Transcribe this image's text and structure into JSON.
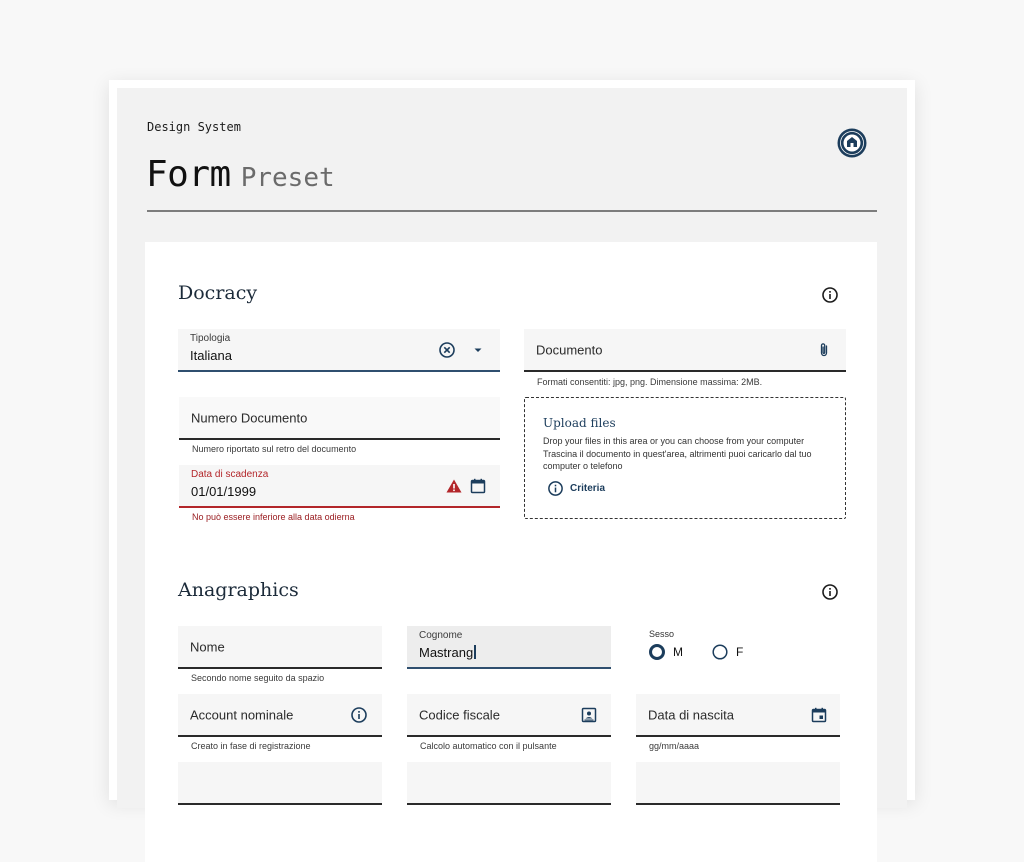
{
  "header": {
    "eyebrow": "Design System",
    "title": "Form",
    "subtitle": "Preset"
  },
  "docracy": {
    "title": "Docracy",
    "tipologia": {
      "label": "Tipologia",
      "value": "Italiana"
    },
    "documento": {
      "placeholder": "Documento",
      "helper": "Formati consentiti: jpg, png. Dimensione massima: 2MB."
    },
    "numero_documento": {
      "placeholder": "Numero Documento",
      "helper": "Numero riportato sul retro del documento"
    },
    "data_scadenza": {
      "label": "Data di scadenza",
      "value": "01/01/1999",
      "error": "No può essere inferiore alla data odierna"
    },
    "upload": {
      "title": "Upload files",
      "line1": "Drop your files in this area or you can choose from your computer",
      "line2": "Trascina il documento in quest'area, altrimenti puoi caricarlo dal tuo computer o telefono",
      "criteria": "Criteria"
    }
  },
  "anagraphics": {
    "title": "Anagraphics",
    "nome": {
      "placeholder": "Nome",
      "helper": "Secondo nome seguito da spazio"
    },
    "cognome": {
      "label": "Cognome",
      "value": "Mastrang"
    },
    "sesso": {
      "label": "Sesso",
      "options": [
        "M",
        "F"
      ],
      "selected": "M"
    },
    "account": {
      "placeholder": "Account nominale",
      "helper": "Creato in fase di registrazione"
    },
    "codice_fiscale": {
      "placeholder": "Codice fiscale",
      "helper": "Calcolo automatico con il pulsante"
    },
    "data_nascita": {
      "placeholder": "Data di nascita",
      "helper": "gg/mm/aaaa"
    }
  },
  "colors": {
    "accent": "#1c3d5c",
    "error": "#b3262a",
    "field_bg": "#f6f6f6"
  }
}
